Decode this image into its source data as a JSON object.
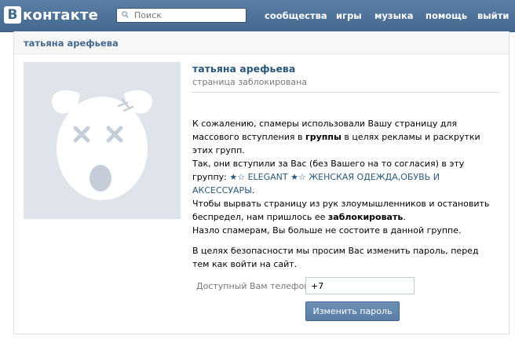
{
  "header": {
    "logo_letter": "В",
    "logo_text": "контакте",
    "search_placeholder": "Поиск",
    "nav": {
      "communities": "сообщества",
      "games": "игры",
      "music": "музыка",
      "help": "помощь",
      "logout": "выйти"
    }
  },
  "page": {
    "title": "татьяна арефьева"
  },
  "profile": {
    "name": "татьяна арефьева",
    "status": "страница заблокирована",
    "avatar_icon": "blocked-dog-avatar-icon"
  },
  "message": {
    "p1_a": "К сожалению, спамеры использовали Вашу страницу для массового вступления в ",
    "p1_bold": "группы",
    "p1_b": " в целях рекламы и раскрутки этих групп.",
    "p2_a": "Так, они вступили за Вас (без Вашего на то согласия) в эту группу: ",
    "p2_group": "★☆ ELEGANT ★☆ ЖЕНСКАЯ ОДЕЖДА,ОБУВЬ И АКСЕССУАРЫ",
    "p2_b": ".",
    "p3_a": "Чтобы вырвать страницу из рук злоумышленников и остановить беспредел, нам пришлось ее ",
    "p3_bold": "заблокировать",
    "p3_b": ".",
    "p3_c": "Назло спамерам, Вы больше не состоите в данной группе.",
    "p4": "В целях безопасности мы просим Вас изменить пароль, перед тем как войти на сайт."
  },
  "form": {
    "phone_label": "Доступный Вам телефон:",
    "phone_value": "+7",
    "submit_label": "Изменить пароль"
  },
  "colors": {
    "header_bg": "#4c6f96",
    "accent": "#2b587a",
    "avatar_bg": "#dfe4ea"
  }
}
